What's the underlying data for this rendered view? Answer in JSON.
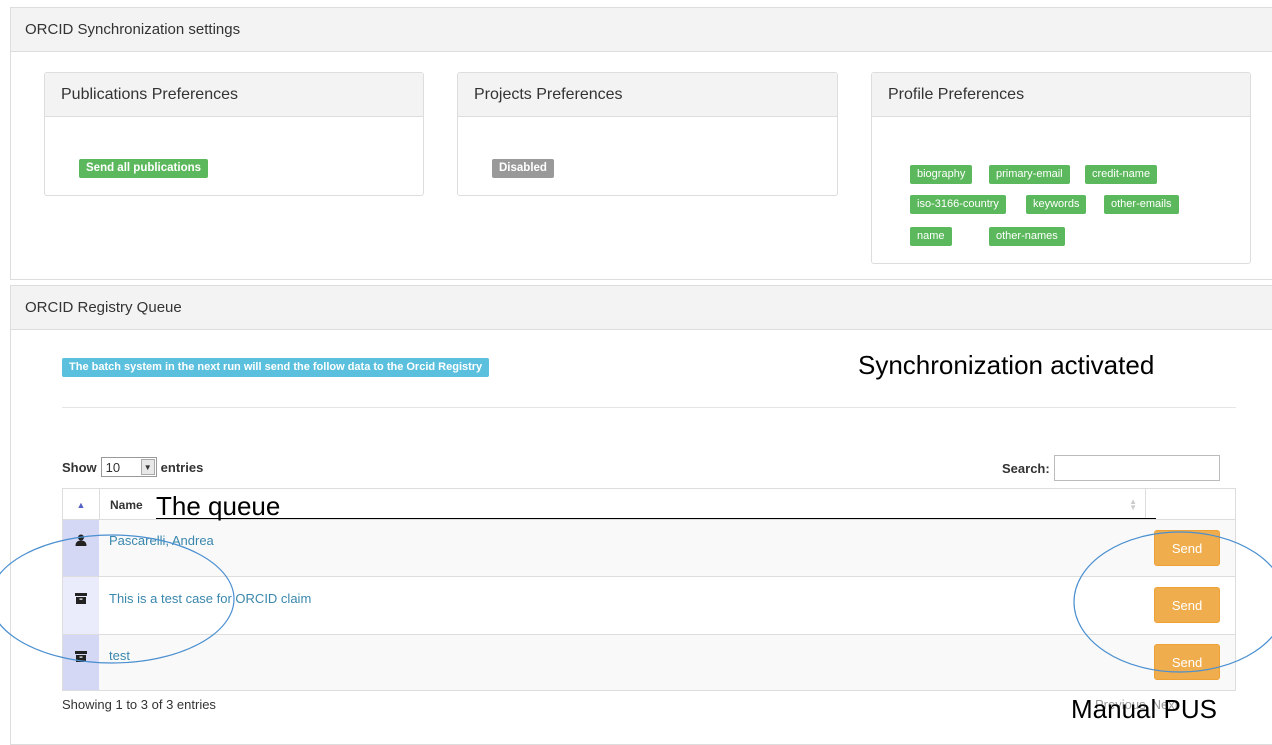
{
  "sync_panel": {
    "title": "ORCID Synchronization settings",
    "publications": {
      "title": "Publications Preferences",
      "badge": "Send all publications"
    },
    "projects": {
      "title": "Projects Preferences",
      "badge": "Disabled"
    },
    "profile": {
      "title": "Profile Preferences",
      "tags": [
        "biography",
        "primary-email",
        "credit-name",
        "iso-3166-country",
        "keywords",
        "other-emails",
        "name",
        "other-names"
      ]
    }
  },
  "queue_panel": {
    "title": "ORCID Registry Queue",
    "info": "The batch system in the next run will send the follow data to the Orcid Registry",
    "show_label": "Show",
    "entries_value": "10",
    "entries_label": "entries",
    "search_label": "Search:",
    "search_value": "",
    "column_name": "Name",
    "rows": [
      {
        "icon": "person-icon",
        "name": "Pascarelli, Andrea",
        "action": "Send"
      },
      {
        "icon": "archive-icon",
        "name": "This is a test case for ORCID claim",
        "action": "Send"
      },
      {
        "icon": "archive-icon",
        "name": "test",
        "action": "Send"
      }
    ],
    "info_footer": "Showing 1 to 3 of 3 entries",
    "pagination": {
      "previous": "Previous",
      "next": "Next"
    }
  },
  "annotations": {
    "sync_activated": "Synchronization activated",
    "queue": "The queue",
    "manual_push": "Manual PUS",
    "ellipse_color": "#4a8fd0"
  },
  "colors": {
    "success": "#5cb85c",
    "warning": "#f0ad4e",
    "info": "#5bc0de",
    "disabled": "#999999",
    "link": "#3a87ad"
  }
}
